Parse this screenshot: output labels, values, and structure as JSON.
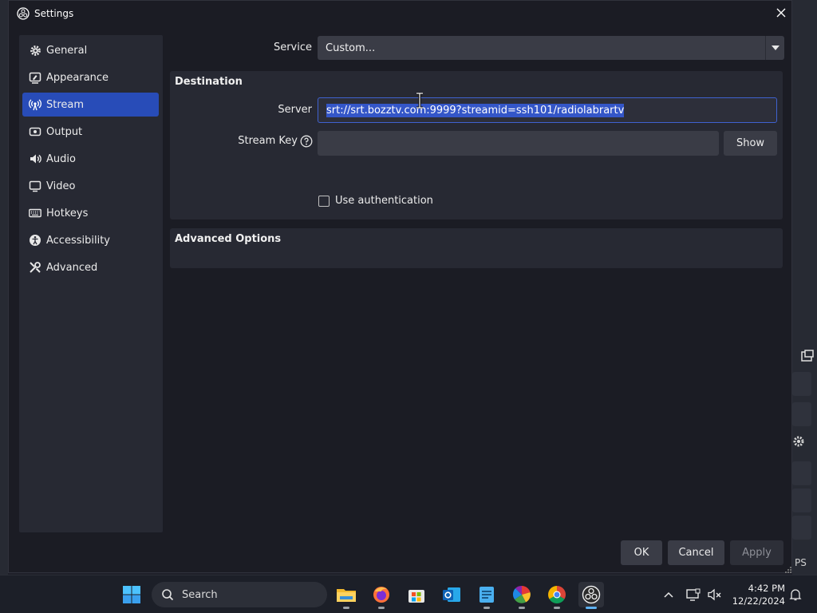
{
  "window": {
    "title": "Settings"
  },
  "sidebar": {
    "items": [
      {
        "label": "General",
        "icon": "gear-icon",
        "active": false
      },
      {
        "label": "Appearance",
        "icon": "appearance-icon",
        "active": false
      },
      {
        "label": "Stream",
        "icon": "broadcast-icon",
        "active": true
      },
      {
        "label": "Output",
        "icon": "output-icon",
        "active": false
      },
      {
        "label": "Audio",
        "icon": "speaker-icon",
        "active": false
      },
      {
        "label": "Video",
        "icon": "monitor-icon",
        "active": false
      },
      {
        "label": "Hotkeys",
        "icon": "keyboard-icon",
        "active": false
      },
      {
        "label": "Accessibility",
        "icon": "accessibility-icon",
        "active": false
      },
      {
        "label": "Advanced",
        "icon": "tools-icon",
        "active": false
      }
    ]
  },
  "service": {
    "label": "Service",
    "value": "Custom..."
  },
  "destination": {
    "title": "Destination",
    "server_label": "Server",
    "server_value": "srt://srt.bozztv.com:9999?streamid=ssh101/radiolabrartv",
    "stream_key_label": "Stream Key",
    "stream_key_value": "",
    "show_button": "Show",
    "use_auth_label": "Use authentication",
    "use_auth_checked": false
  },
  "advanced_options": {
    "title": "Advanced Options"
  },
  "footer": {
    "ok": "OK",
    "cancel": "Cancel",
    "apply": "Apply"
  },
  "background": {
    "fps_fragment": "PS"
  },
  "taskbar": {
    "search_label": "Search",
    "apps": [
      "file-explorer-icon",
      "firefox-icon",
      "microsoft-store-icon",
      "outlook-icon",
      "notepad-icon",
      "color-app-icon",
      "chrome-icon",
      "obs-icon"
    ],
    "time": "4:42 PM",
    "date": "12/22/2024"
  },
  "colors": {
    "accent": "#284cb8",
    "selection": "#3456c8",
    "dialog_bg": "#1b1c24",
    "panel_bg": "#272933"
  }
}
